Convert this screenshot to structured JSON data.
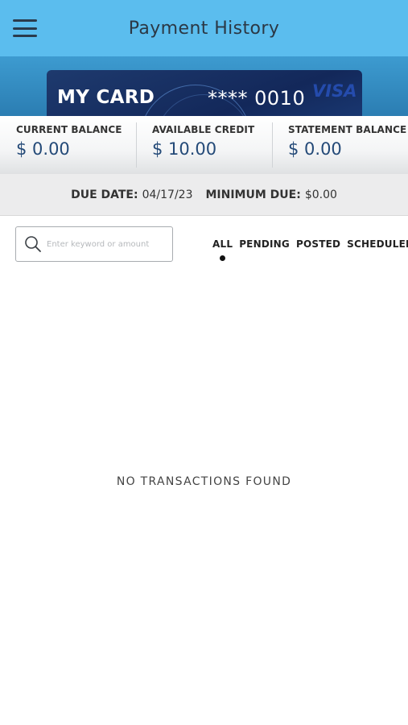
{
  "header": {
    "title": "Payment History",
    "menu_icon": "hamburger-menu-icon"
  },
  "card": {
    "name": "MY CARD",
    "number": "**** 0010",
    "brand": "VISA"
  },
  "balances": [
    {
      "label": "CURRENT BALANCE",
      "value": "$ 0.00"
    },
    {
      "label": "AVAILABLE CREDIT",
      "value": "$ 10.00"
    },
    {
      "label": "STATEMENT BALANCE",
      "value": "$ 0.00"
    }
  ],
  "due": {
    "due_date_label": "DUE DATE:",
    "due_date": "04/17/23",
    "minimum_due_label": "MINIMUM DUE:",
    "minimum_due": "$0.00"
  },
  "search": {
    "placeholder": "Enter keyword or amount",
    "icon": "search-icon"
  },
  "tabs": [
    {
      "label": "ALL",
      "selected": true
    },
    {
      "label": "PENDING",
      "selected": false
    },
    {
      "label": "POSTED",
      "selected": false
    },
    {
      "label": "SCHEDULED",
      "selected": false
    }
  ],
  "empty_message": "NO TRANSACTIONS FOUND",
  "colors": {
    "header_bg": "#5bbdee",
    "card_bg": "#1e3a6e",
    "value_text": "#244a78"
  }
}
